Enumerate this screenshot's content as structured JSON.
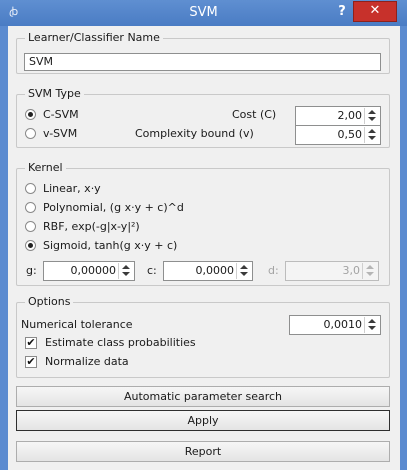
{
  "window": {
    "title": "SVM",
    "help_label": "?",
    "close_label": "✕",
    "app_icon_glyph": "ꞗ",
    "titlebar_color": "#4a7cc4",
    "close_color": "#c7312b"
  },
  "learner": {
    "title": "Learner/Classifier Name",
    "value": "SVM"
  },
  "svm_type": {
    "title": "SVM Type",
    "c_svm_label": "C-SVM",
    "v_svm_label": "v-SVM",
    "selected": "C-SVM",
    "cost_label": "Cost (C)",
    "cost_value": "2,00",
    "complexity_label": "Complexity bound (v)",
    "complexity_value": "0,50"
  },
  "kernel": {
    "title": "Kernel",
    "options": [
      {
        "label": "Linear,  x·y",
        "checked": false
      },
      {
        "label": "Polynomial,  (g x·y + c)^d",
        "checked": false
      },
      {
        "label": "RBF,  exp(-g|x-y|²)",
        "checked": false
      },
      {
        "label": "Sigmoid,  tanh(g x·y + c)",
        "checked": true
      }
    ],
    "g_label": "g:",
    "g_value": "0,00000",
    "c_label": "c:",
    "c_value": "0,0000",
    "d_label": "d:",
    "d_value": "3,0"
  },
  "options": {
    "title": "Options",
    "tolerance_label": "Numerical tolerance",
    "tolerance_value": "0,0010",
    "estimate_label": "Estimate class probabilities",
    "estimate_checked": true,
    "normalize_label": "Normalize data",
    "normalize_checked": true,
    "check_glyph": "✔"
  },
  "buttons": {
    "auto_search": "Automatic parameter search",
    "apply": "Apply",
    "report": "Report"
  }
}
